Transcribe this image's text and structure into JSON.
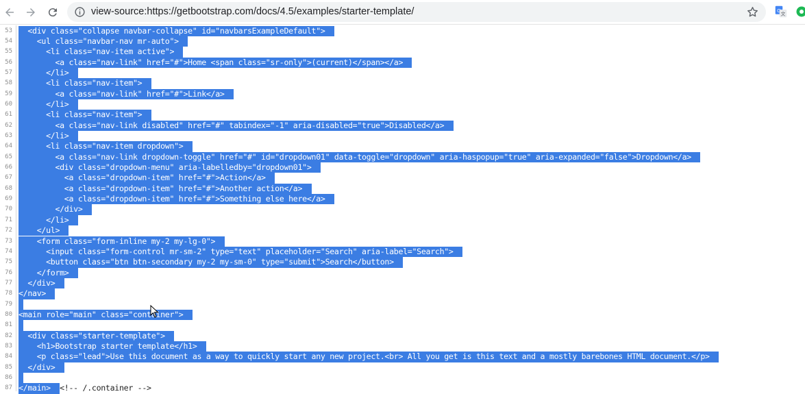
{
  "browser": {
    "url": "view-source:https://getbootstrap.com/docs/4.5/examples/starter-template/",
    "icons": {
      "back": "arrow-left-icon",
      "forward": "arrow-right-icon",
      "reload": "reload-icon",
      "info": "info-icon",
      "bookmark": "star-icon",
      "translate": "translate-icon",
      "extension": "green-extension-icon"
    }
  },
  "source": {
    "selection_color": "#3b7de3",
    "lines": [
      {
        "num": "53",
        "text": "  <div class=\"collapse navbar-collapse\" id=\"navbarsExampleDefault\">"
      },
      {
        "num": "54",
        "text": "    <ul class=\"navbar-nav mr-auto\">"
      },
      {
        "num": "55",
        "text": "      <li class=\"nav-item active\">"
      },
      {
        "num": "56",
        "text": "        <a class=\"nav-link\" href=\"#\">Home <span class=\"sr-only\">(current)</span></a>"
      },
      {
        "num": "57",
        "text": "      </li>"
      },
      {
        "num": "58",
        "text": "      <li class=\"nav-item\">"
      },
      {
        "num": "59",
        "text": "        <a class=\"nav-link\" href=\"#\">Link</a>"
      },
      {
        "num": "60",
        "text": "      </li>"
      },
      {
        "num": "61",
        "text": "      <li class=\"nav-item\">"
      },
      {
        "num": "62",
        "text": "        <a class=\"nav-link disabled\" href=\"#\" tabindex=\"-1\" aria-disabled=\"true\">Disabled</a>"
      },
      {
        "num": "63",
        "text": "      </li>"
      },
      {
        "num": "64",
        "text": "      <li class=\"nav-item dropdown\">"
      },
      {
        "num": "65",
        "text": "        <a class=\"nav-link dropdown-toggle\" href=\"#\" id=\"dropdown01\" data-toggle=\"dropdown\" aria-haspopup=\"true\" aria-expanded=\"false\">Dropdown</a>"
      },
      {
        "num": "66",
        "text": "        <div class=\"dropdown-menu\" aria-labelledby=\"dropdown01\">"
      },
      {
        "num": "67",
        "text": "          <a class=\"dropdown-item\" href=\"#\">Action</a>"
      },
      {
        "num": "68",
        "text": "          <a class=\"dropdown-item\" href=\"#\">Another action</a>"
      },
      {
        "num": "69",
        "text": "          <a class=\"dropdown-item\" href=\"#\">Something else here</a>"
      },
      {
        "num": "70",
        "text": "        </div>"
      },
      {
        "num": "71",
        "text": "      </li>"
      },
      {
        "num": "72",
        "text": "    </ul>"
      },
      {
        "num": "73",
        "text": "    <form class=\"form-inline my-2 my-lg-0\">"
      },
      {
        "num": "74",
        "text": "      <input class=\"form-control mr-sm-2\" type=\"text\" placeholder=\"Search\" aria-label=\"Search\">"
      },
      {
        "num": "75",
        "text": "      <button class=\"btn btn-secondary my-2 my-sm-0\" type=\"submit\">Search</button>"
      },
      {
        "num": "76",
        "text": "    </form>"
      },
      {
        "num": "77",
        "text": "  </div>"
      },
      {
        "num": "78",
        "text": "</nav>"
      },
      {
        "num": "79",
        "text": ""
      },
      {
        "num": "80",
        "text": "<main role=\"main\" class=\"container\">"
      },
      {
        "num": "81",
        "text": ""
      },
      {
        "num": "82",
        "text": "  <div class=\"starter-template\">"
      },
      {
        "num": "83",
        "text": "    <h1>Bootstrap starter template</h1>"
      },
      {
        "num": "84",
        "text": "    <p class=\"lead\">Use this document as a way to quickly start any new project.<br> All you get is this text and a mostly barebones HTML document.</p>"
      },
      {
        "num": "85",
        "text": "  </div>"
      },
      {
        "num": "86",
        "text": ""
      },
      {
        "num": "87",
        "text": "</main>",
        "after": "<!-- /.container -->"
      }
    ]
  }
}
